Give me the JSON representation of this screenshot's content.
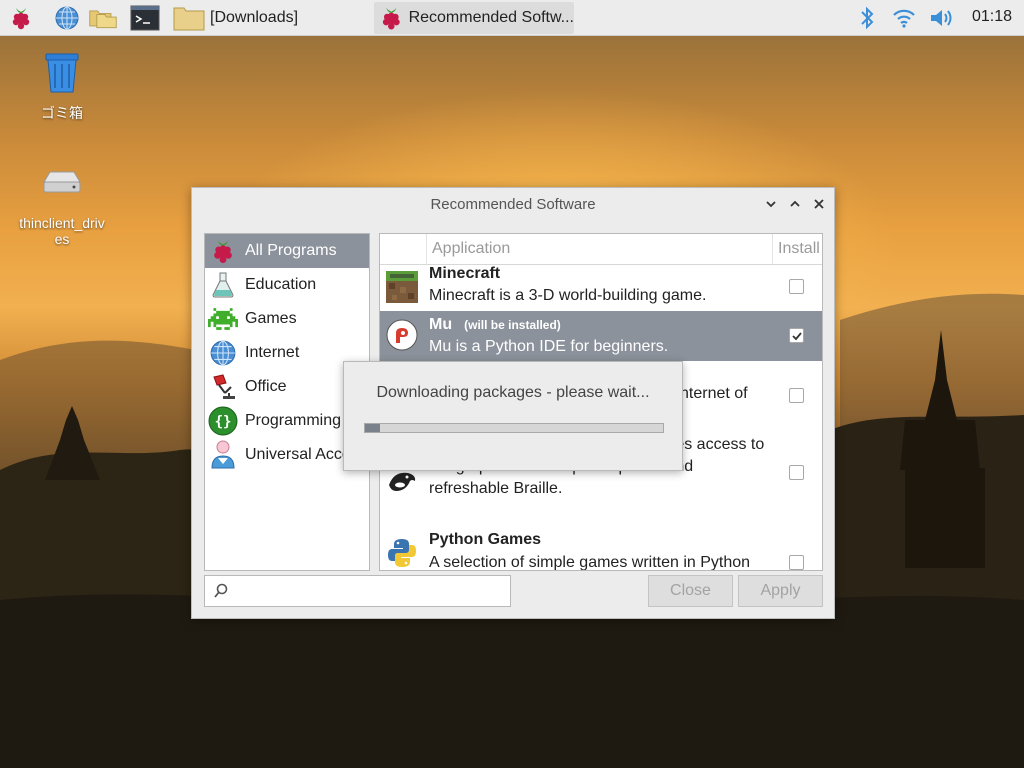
{
  "taskbar": {
    "downloads_label": "[Downloads]",
    "app_label": "Recommended Softw...",
    "clock": "01:18"
  },
  "desktop": {
    "trash_label": "ゴミ箱",
    "drive_label_line1": "thinclient_driv",
    "drive_label_line2": "es"
  },
  "window": {
    "title": "Recommended Software",
    "categories": [
      {
        "label": "All Programs"
      },
      {
        "label": "Education"
      },
      {
        "label": "Games"
      },
      {
        "label": "Internet"
      },
      {
        "label": "Office"
      },
      {
        "label": "Programming"
      },
      {
        "label": "Universal Acce"
      }
    ],
    "columns": {
      "application": "Application",
      "install": "Install"
    },
    "apps": [
      {
        "name": "Minecraft",
        "tag": "",
        "desc": "Minecraft is a 3-D world-building game.",
        "installed": false
      },
      {
        "name": "Mu",
        "tag": "(will be installed)",
        "desc": "Mu is a Python IDE for beginners.",
        "installed": true
      },
      {
        "name": "",
        "tag": "",
        "desc": "nternet of",
        "installed": false
      },
      {
        "name": "",
        "tag": "",
        "desc_line1": "Orca is a screen reader that provides access to",
        "desc_line2": "the graphical desktop via speech and",
        "desc_line3": "refreshable Braille.",
        "installed": false
      },
      {
        "name": "Python Games",
        "tag": "",
        "desc": "A selection of simple games written in Python",
        "installed": false
      }
    ],
    "search": {
      "value": ""
    },
    "close_label": "Close",
    "apply_label": "Apply"
  },
  "progress": {
    "message": "Downloading packages - please wait...",
    "fraction": 0.05
  },
  "colors": {
    "selection": "#8c929b",
    "panel": "#ececec",
    "accent_blue": "#3b8fd9"
  }
}
